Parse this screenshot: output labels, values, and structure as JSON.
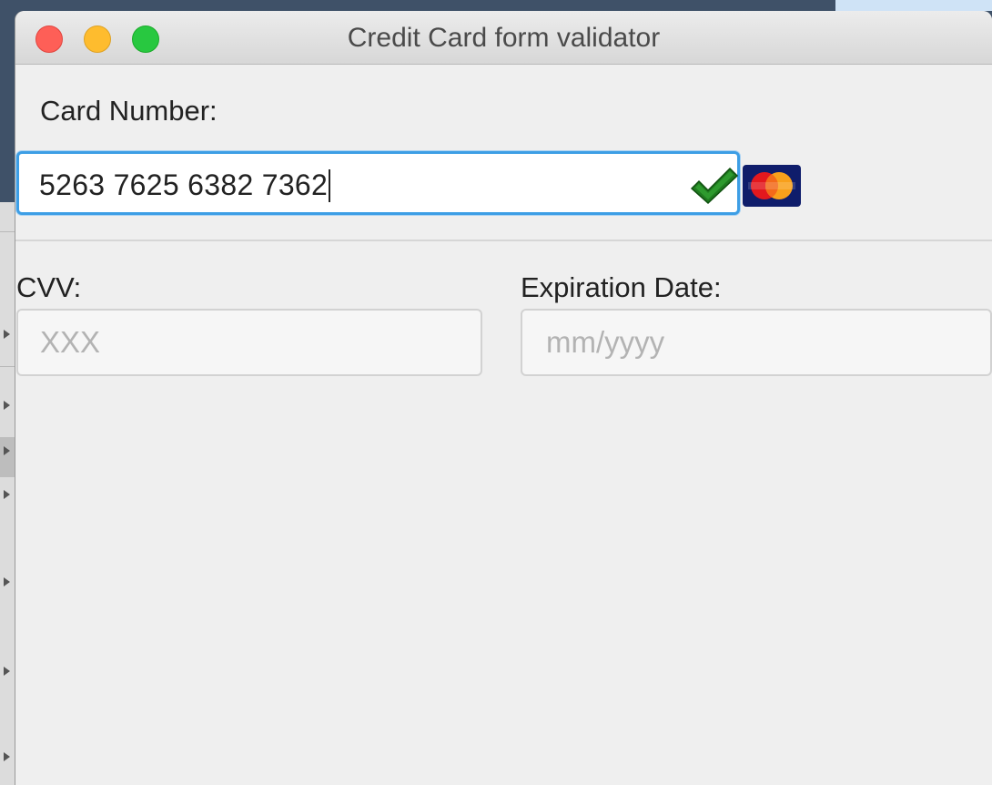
{
  "window": {
    "title": "Credit Card form validator"
  },
  "form": {
    "card_number": {
      "label": "Card Number:",
      "value": "5263 7625 6382 7362",
      "valid": true,
      "card_brand": "mastercard-icon",
      "valid_icon": "check-icon"
    },
    "cvv": {
      "label": "CVV:",
      "placeholder": "XXX",
      "value": ""
    },
    "expiration": {
      "label": "Expiration Date:",
      "placeholder": "mm/yyyy",
      "value": ""
    }
  },
  "colors": {
    "focus_ring": "#3d9ee5",
    "valid_check": "#1f7a1f",
    "close": "#fe5f57",
    "minimize": "#febc2e",
    "maximize": "#28c840"
  }
}
